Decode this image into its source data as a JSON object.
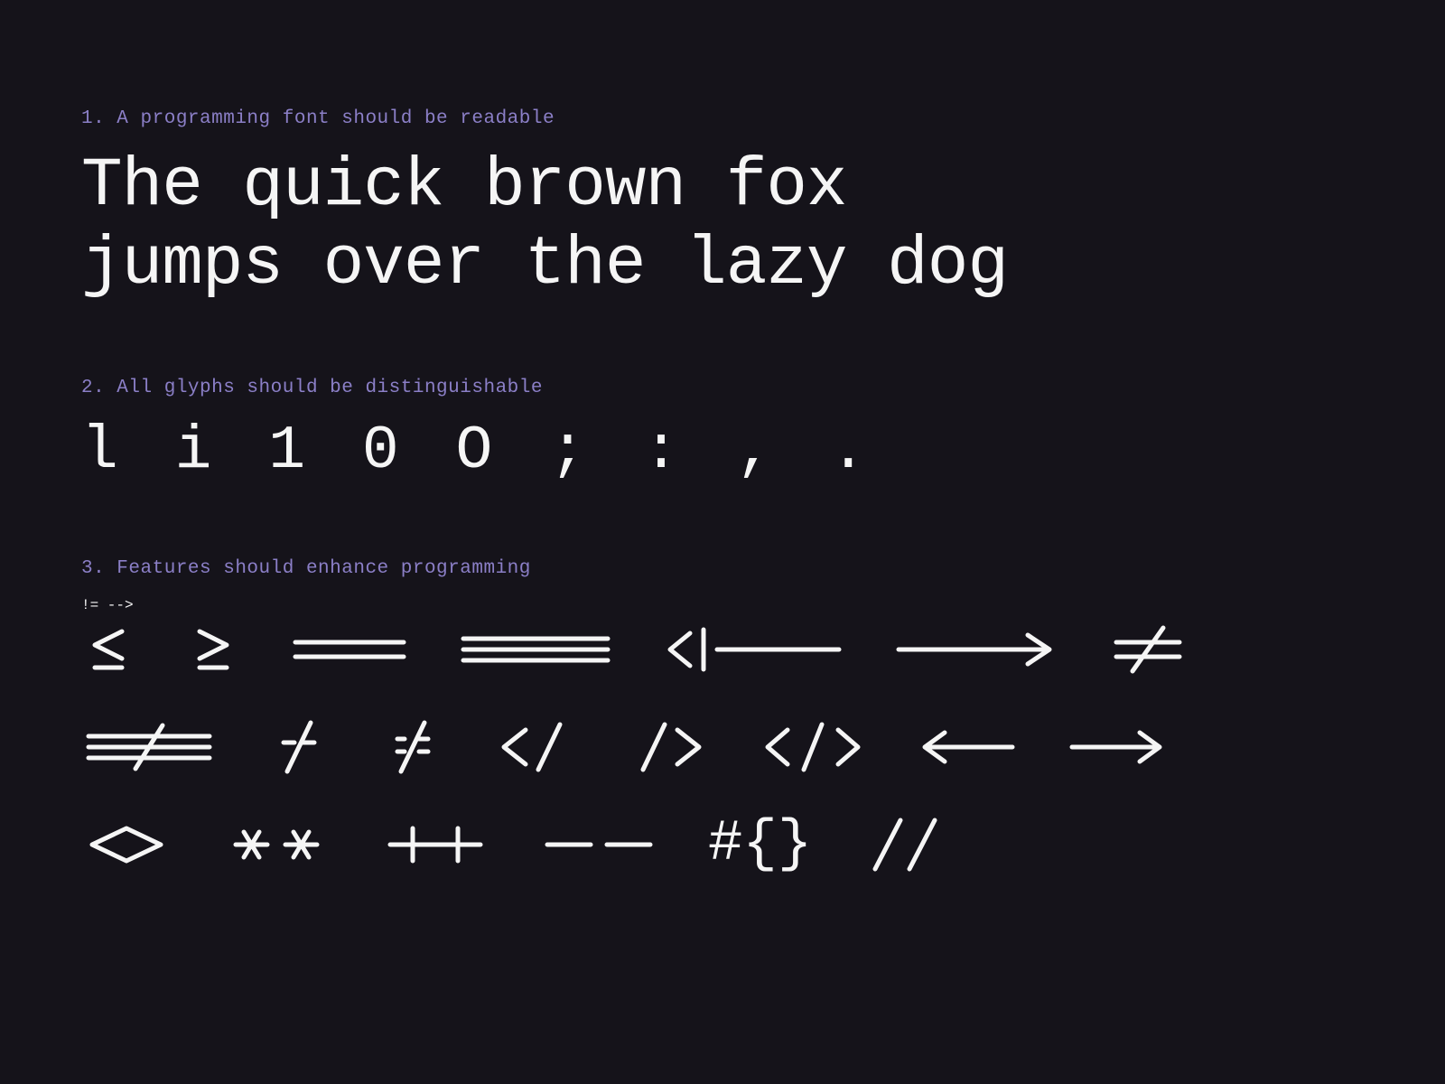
{
  "sections": {
    "readable": {
      "label": "1. A programming font should be readable",
      "pangram": "The quick brown fox\njumps over the lazy dog"
    },
    "distinguishable": {
      "label": "2. All glyphs should be distinguishable",
      "glyphs": "l i 1  0 O   ; :   , ."
    },
    "features": {
      "label": "3. Features should enhance programming",
      "ligatures_row1": [
        "<=",
        ">=",
        "==",
        "===",
        "<!--",
        "-->",
        "!="
      ],
      "ligatures_row2": [
        "!==",
        "/=",
        "/==",
        "</",
        "/>",
        "</>",
        "<-",
        "->"
      ],
      "ligatures_row3": [
        "<>",
        "**",
        "++",
        "--",
        "#{}",
        "//"
      ]
    }
  }
}
